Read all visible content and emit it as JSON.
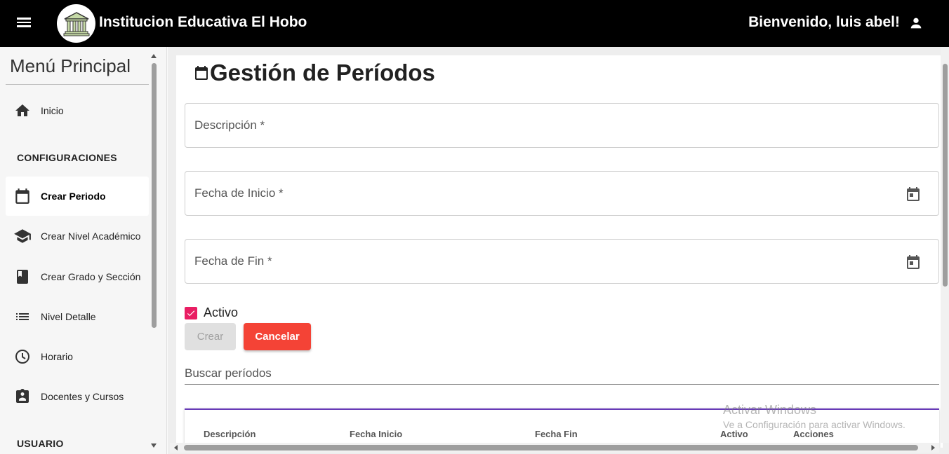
{
  "header": {
    "title": "Institucion Educativa El Hobo",
    "welcome": "Bienvenido, luis abel!"
  },
  "sidebar": {
    "title": "Menú Principal",
    "items_top": [
      {
        "label": "Inicio",
        "icon": "home-icon"
      }
    ],
    "section_config": "CONFIGURACIONES",
    "items_config": [
      {
        "label": "Crear Periodo",
        "icon": "calendar-icon",
        "active": true
      },
      {
        "label": "Crear Nivel Académico",
        "icon": "school-icon"
      },
      {
        "label": "Crear Grado y Sección",
        "icon": "book-icon"
      },
      {
        "label": "Nivel Detalle",
        "icon": "list-icon"
      },
      {
        "label": "Horario",
        "icon": "clock-icon"
      },
      {
        "label": "Docentes y Cursos",
        "icon": "clipboard-user-icon"
      }
    ],
    "section_user": "USUARIO"
  },
  "main": {
    "title": "Gestión de Períodos",
    "fields": {
      "descripcion": "Descripción *",
      "fecha_inicio": "Fecha de Inicio *",
      "fecha_fin": "Fecha de Fin *"
    },
    "checkbox_label": "Activo",
    "checkbox_checked": true,
    "btn_crear": "Crear",
    "btn_cancelar": "Cancelar",
    "search_placeholder": "Buscar períodos",
    "table_headers": [
      "Descripción",
      "Fecha Inicio",
      "Fecha Fin",
      "Activo",
      "Acciones"
    ]
  },
  "watermark": {
    "line1": "Activar Windows",
    "line2": "Ve a Configuración para activar Windows."
  },
  "colors": {
    "topbar": "#000000",
    "checkbox": "#e91e63",
    "cancel": "#f44336",
    "table_accent": "#673ab7"
  }
}
